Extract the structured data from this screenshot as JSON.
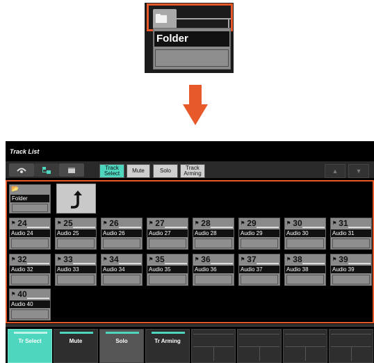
{
  "colors": {
    "accent": "#4fd6bf",
    "highlight": "#e8592a"
  },
  "zoom": {
    "folder_name": "Folder",
    "icon": "folder-icon"
  },
  "title": "Track List",
  "mode_icons": [
    "eye-icon",
    "folder-tree-icon",
    "window-icon"
  ],
  "tabs": [
    {
      "label": "Track\nSelect",
      "active": true
    },
    {
      "label": "Mute",
      "active": false
    },
    {
      "label": "Solo",
      "active": false
    },
    {
      "label": "Track\nArming",
      "active": false
    }
  ],
  "folder": {
    "name": "Folder",
    "icon": "folder-open-icon"
  },
  "back_icon": "return-arrow-icon",
  "tracks": [
    {
      "num": "24",
      "name": "Audio 24"
    },
    {
      "num": "25",
      "name": "Audio 25"
    },
    {
      "num": "26",
      "name": "Audio 26"
    },
    {
      "num": "27",
      "name": "Audio 27"
    },
    {
      "num": "28",
      "name": "Audio 28"
    },
    {
      "num": "29",
      "name": "Audio 29"
    },
    {
      "num": "30",
      "name": "Audio 30"
    },
    {
      "num": "31",
      "name": "Audio 31"
    },
    {
      "num": "32",
      "name": "Audio 32"
    },
    {
      "num": "33",
      "name": "Audio 33"
    },
    {
      "num": "34",
      "name": "Audio 34"
    },
    {
      "num": "35",
      "name": "Audio 35"
    },
    {
      "num": "36",
      "name": "Audio 36"
    },
    {
      "num": "37",
      "name": "Audio 37"
    },
    {
      "num": "38",
      "name": "Audio 38"
    },
    {
      "num": "39",
      "name": "Audio 39"
    },
    {
      "num": "40",
      "name": "Audio 40"
    }
  ],
  "bottom": [
    {
      "label": "Tr Select",
      "active": true
    },
    {
      "label": "Mute",
      "active": false
    },
    {
      "label": "Solo",
      "active": false
    },
    {
      "label": "Tr Arming",
      "active": false
    }
  ]
}
